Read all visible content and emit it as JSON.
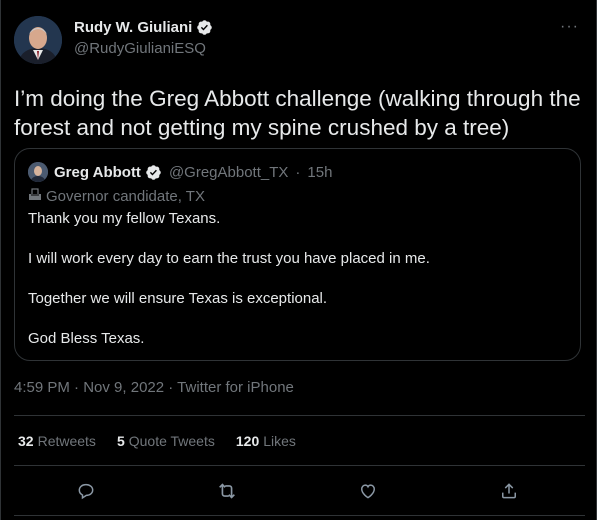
{
  "author": {
    "name": "Rudy W. Giuliani",
    "handle": "@RudyGiulianiESQ"
  },
  "more_label": "···",
  "tweet_text": "I’m doing the Greg Abbott challenge (walking through the forest and not getting my spine crushed by a tree)",
  "quoted": {
    "name": "Greg Abbott",
    "handle": "@GregAbbott_TX",
    "separator": "·",
    "time": "15h",
    "label": "Governor candidate, TX",
    "paragraphs": [
      "Thank you my fellow Texans.",
      "I will work every day to earn the trust you have placed in me.",
      "Together we will ensure Texas is exceptional.",
      "God Bless Texas."
    ]
  },
  "meta": {
    "time": "4:59 PM",
    "sep1": " · ",
    "date": "Nov 9, 2022",
    "sep2": " · ",
    "source": "Twitter for iPhone"
  },
  "stats": {
    "retweets_count": "32",
    "retweets_label": "Retweets",
    "quotes_count": "5",
    "quotes_label": "Quote Tweets",
    "likes_count": "120",
    "likes_label": "Likes"
  },
  "icons": {
    "verified": "verified-badge-icon",
    "reply": "reply-icon",
    "retweet": "retweet-icon",
    "like": "heart-icon",
    "share": "share-icon"
  },
  "colors": {
    "background": "#000000",
    "text": "#e7e9ea",
    "secondary": "#71767b",
    "border": "#2f3336"
  }
}
